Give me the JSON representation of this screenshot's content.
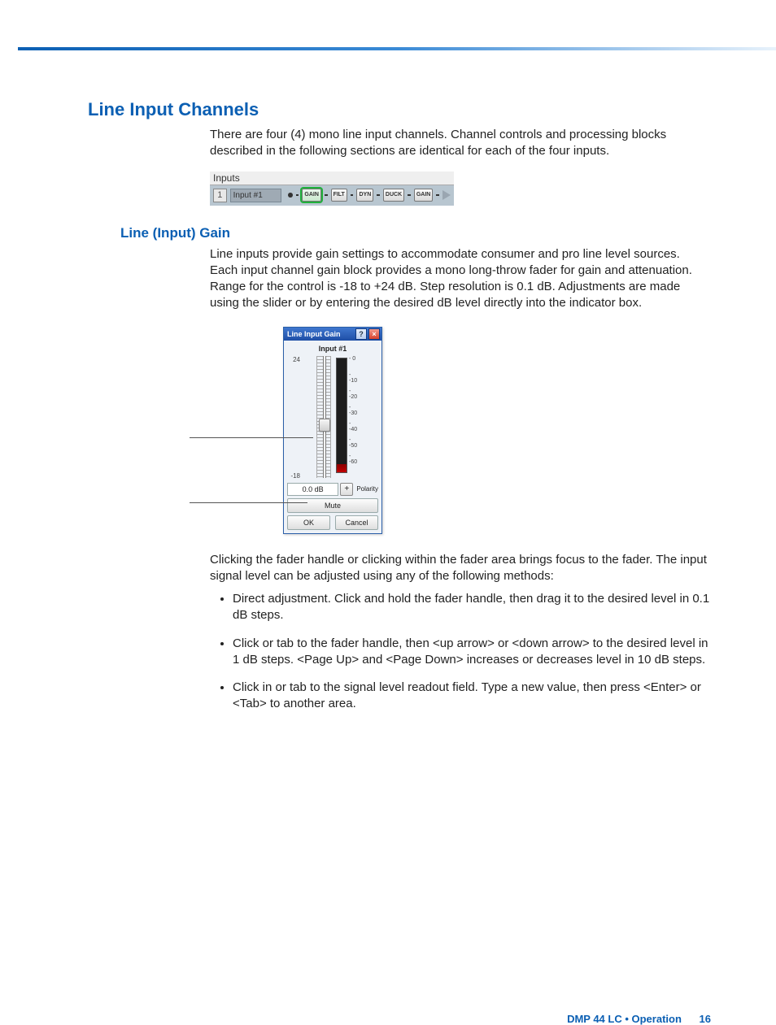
{
  "heading_main": "Line Input Channels",
  "intro_para": "There are four (4) mono line input channels. Channel controls and processing blocks described in the following sections are identical for each of the four inputs.",
  "inputs_strip": {
    "header": "Inputs",
    "channel_number": "1",
    "channel_label": "Input #1",
    "blocks": [
      "GAIN",
      "FILT",
      "DYN",
      "DUCK",
      "GAIN"
    ],
    "selected_index": 0
  },
  "heading_sub": "Line (Input) Gain",
  "gain_para": "Line inputs provide gain settings to accommodate consumer and pro line level sources. Each input channel gain block provides a mono long-throw fader for gain and attenuation. Range for the control is -18 to +24 dB. Step resolution is 0.1 dB. Adjustments are made using the slider or by entering the desired dB level directly into the indicator box.",
  "gain_dialog": {
    "title": "Line Input Gain",
    "input_label": "Input #1",
    "scale_top": "24",
    "scale_bottom": "-18",
    "meter_ticks": [
      "- 0",
      "- -10",
      "- -20",
      "- -30",
      "- -40",
      "- -50",
      "- -60"
    ],
    "db_value": "0.0 dB",
    "polarity_symbol": "+",
    "polarity_label": "Polarity",
    "mute_label": "Mute",
    "ok_label": "OK",
    "cancel_label": "Cancel",
    "fader_position_ratio": 0.57
  },
  "para_after": "Clicking the fader handle or clicking within the fader area brings focus to the fader. The input signal level can be adjusted using any of the following methods:",
  "bullets": [
    "Direct adjustment. Click and hold the fader handle, then drag it to the desired level in 0.1 dB steps.",
    "Click or tab to the fader handle, then <up arrow> or <down arrow> to the desired level in 1 dB steps. <Page Up> and <Page Down> increases or decreases level in 10 dB steps.",
    "Click in or tab to the signal level readout field. Type a new value, then press <Enter> or <Tab> to another area."
  ],
  "footer": {
    "product": "DMP 44 LC • Operation",
    "page": "16"
  }
}
